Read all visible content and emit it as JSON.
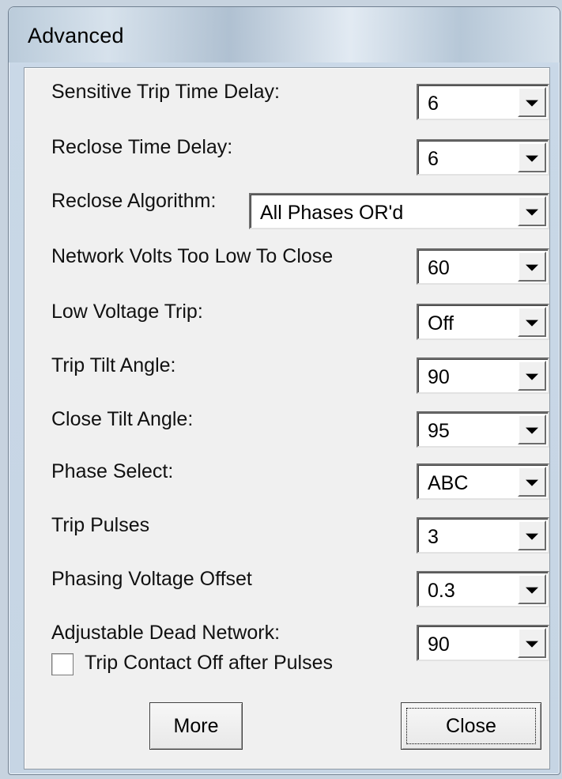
{
  "window": {
    "title": "Advanced"
  },
  "settings": [
    {
      "label": "Sensitive Trip Time Delay:",
      "value": "6"
    },
    {
      "label": "Reclose Time Delay:",
      "value": "6"
    },
    {
      "label": "Reclose Algorithm:",
      "value": "All Phases OR'd"
    },
    {
      "label": "Network Volts Too Low To Close",
      "value": "60"
    },
    {
      "label": "Low Voltage Trip:",
      "value": "Off"
    },
    {
      "label": "Trip Tilt Angle:",
      "value": "90"
    },
    {
      "label": "Close Tilt Angle:",
      "value": "95"
    },
    {
      "label": "Phase Select:",
      "value": "ABC"
    },
    {
      "label": "Trip Pulses",
      "value": "3"
    },
    {
      "label": "Phasing Voltage Offset",
      "value": "0.3"
    },
    {
      "label": "Adjustable Dead Network:",
      "value": "90"
    }
  ],
  "checkbox": {
    "label": "Trip Contact Off after Pulses",
    "checked": false
  },
  "buttons": {
    "more": "More",
    "close": "Close"
  },
  "icons": {
    "dropdown": "chevron-down-icon",
    "checkbox": "checkbox-unchecked"
  }
}
